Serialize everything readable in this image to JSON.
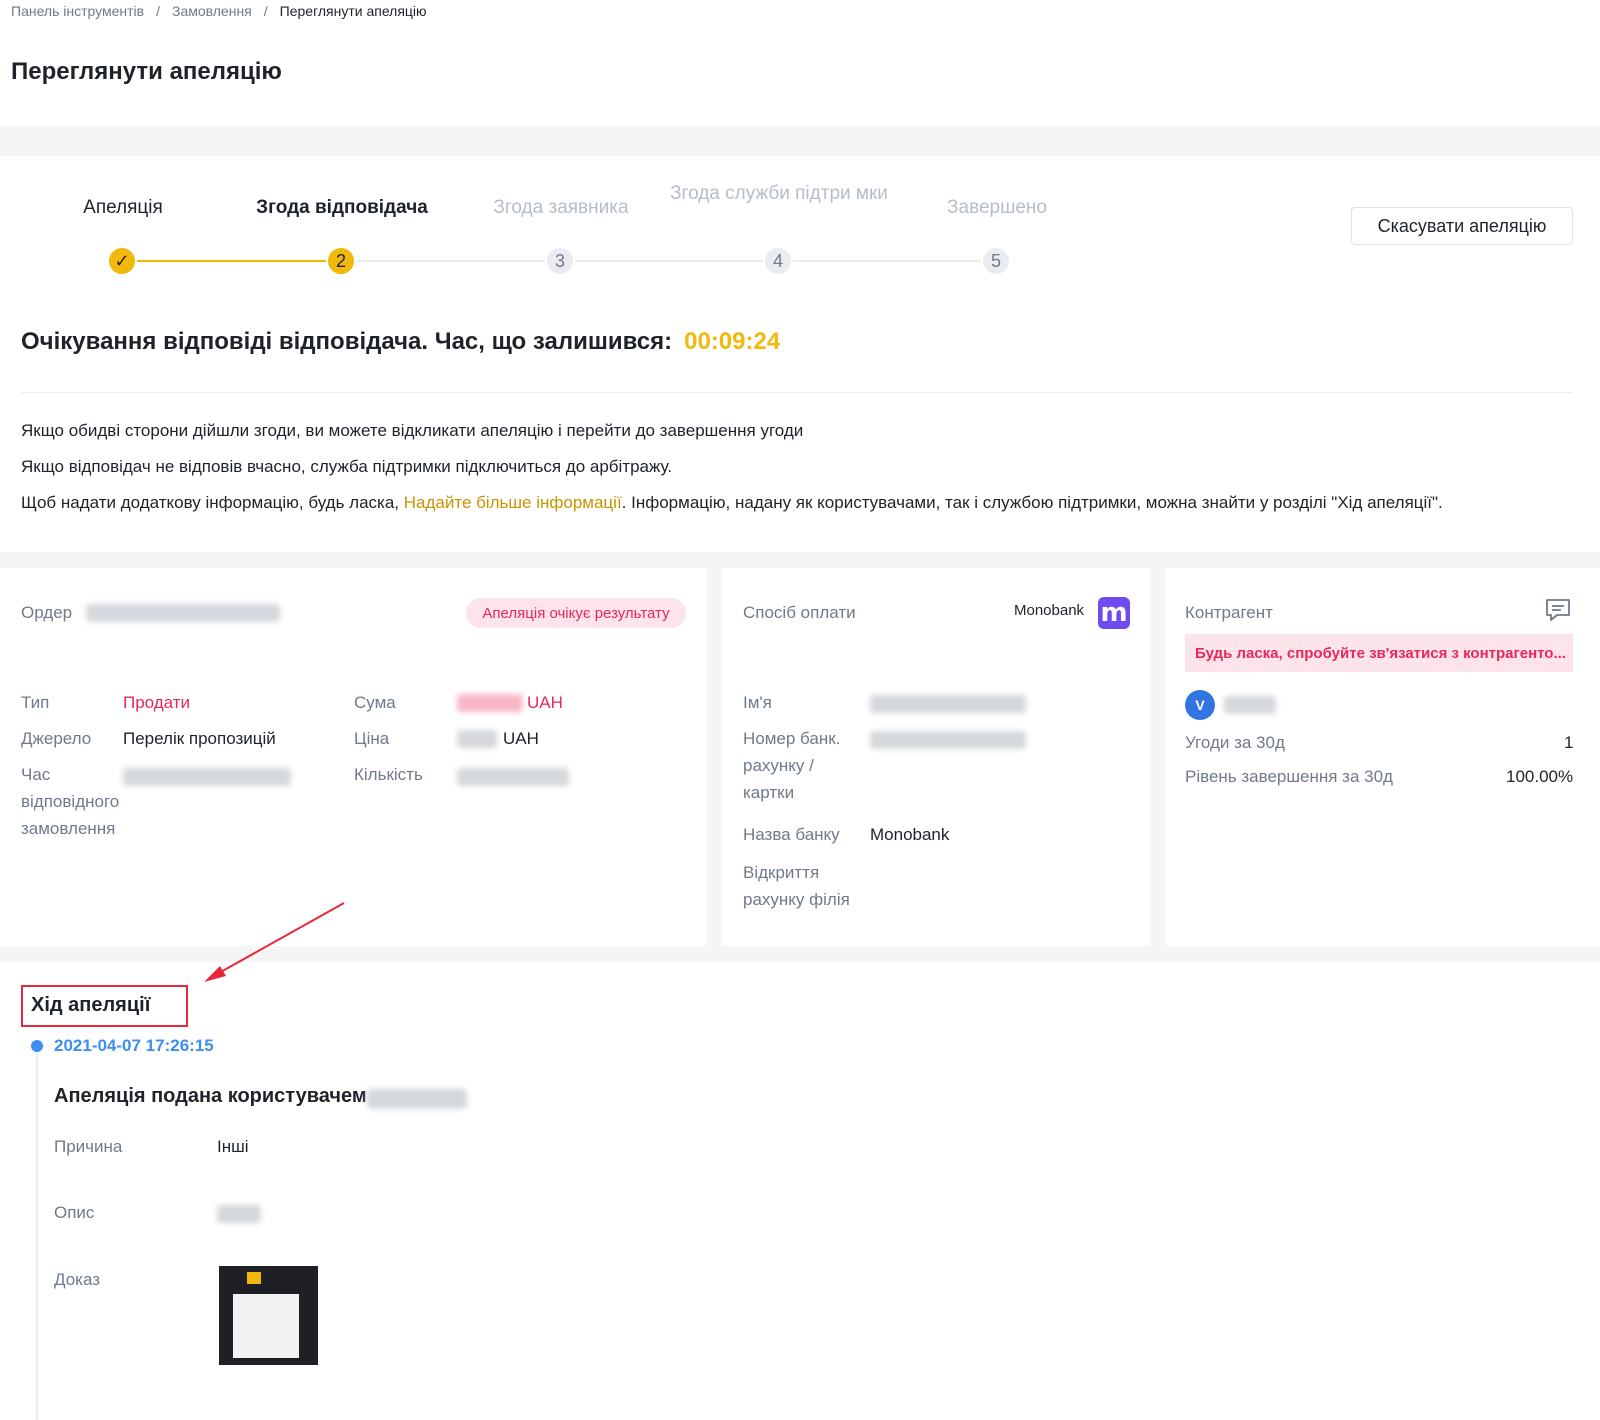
{
  "breadcrumb": {
    "items": [
      "Панель інструментів",
      "Замовлення",
      "Переглянути апеляцію"
    ],
    "separator": "/"
  },
  "page_title": "Переглянути апеляцію",
  "stepper": {
    "steps": [
      {
        "label": "Апеляція",
        "number": "✓",
        "state": "done"
      },
      {
        "label": "Згода відповідача",
        "number": "2",
        "state": "active"
      },
      {
        "label": "Згода заявника",
        "number": "3",
        "state": "pending"
      },
      {
        "label": "Згода служби підтри мки",
        "number": "4",
        "state": "pending"
      },
      {
        "label": "Завершено",
        "number": "5",
        "state": "pending"
      }
    ],
    "cancel_label": "Скасувати апеляцію"
  },
  "waiting": {
    "text": "Очікування відповіді відповідача. Час, що залишився:",
    "timer": "00:09:24"
  },
  "info": {
    "line1": "Якщо обидві сторони дійшли згоди, ви можете відкликати апеляцію і перейти до завершення угоди",
    "line2": "Якщо відповідач не відповів вчасно, служба підтримки підключиться до арбітражу.",
    "line3_before": "Щоб надати додаткову інформацію, будь ласка, ",
    "line3_link": "Надайте більше інформації",
    "line3_after": ". Інформацію, надану як користувачами, так і службою підтримки, можна знайти у розділі \"Хід апеляції\"."
  },
  "order_card": {
    "order_label": "Ордер",
    "status_badge": "Апеляція очікує результату",
    "type_label": "Тип",
    "type_value": "Продати",
    "source_label": "Джерело",
    "source_value": "Перелік пропозицій",
    "time_label": "Час відповідного замовлення",
    "sum_label": "Сума",
    "sum_currency": "UAH",
    "price_label": "Ціна",
    "price_currency": "UAH",
    "quantity_label": "Кількість"
  },
  "payment_card": {
    "method_label": "Спосіб оплати",
    "method_value": "Monobank",
    "method_icon": "m",
    "name_label": "Ім'я",
    "account_label": "Номер банк. рахунку / картки",
    "bank_name_label": "Назва банку",
    "bank_name_value": "Monobank",
    "branch_label": "Відкриття рахунку філія"
  },
  "counterparty_card": {
    "title": "Контрагент",
    "warning": "Будь ласка, спробуйте зв'язатися з контрагенто...",
    "avatar_letter": "V",
    "trades_label": "Угоди за 30д",
    "trades_value": "1",
    "completion_label": "Рівень завершення за 30д",
    "completion_value": "100.00%"
  },
  "progress": {
    "title": "Хід апеляції",
    "time": "2021-04-07 17:26:15",
    "submitted_text": "Апеляція подана користувачем",
    "reason_label": "Причина",
    "reason_value": "Інші",
    "description_label": "Опис",
    "proof_label": "Доказ"
  },
  "colors": {
    "accent": "#f0b90b",
    "link": "#c99400",
    "red": "#e8275a",
    "blue": "#3d8ef0",
    "monobank": "#6f4cf0"
  }
}
